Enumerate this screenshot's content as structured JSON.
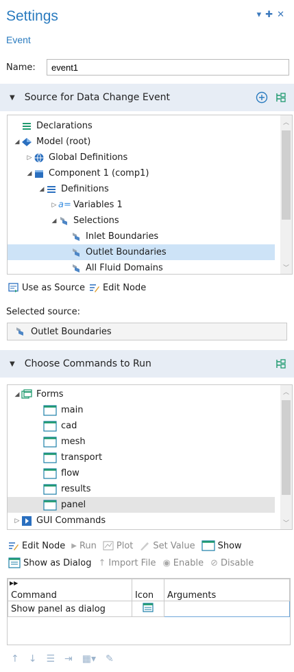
{
  "header": {
    "title": "Settings",
    "subtitle": "Event",
    "controls": "▾ ✚ ✕"
  },
  "name_field": {
    "label": "Name:",
    "value": "event1"
  },
  "section_source": {
    "title": "Source for Data Change Event"
  },
  "source_tree": [
    {
      "label": "Declarations",
      "icon": "declarations-icon"
    },
    {
      "label": "Model (root)",
      "icon": "model-icon"
    },
    {
      "label": "Global Definitions",
      "icon": "globe-icon"
    },
    {
      "label": "Component 1 (comp1)",
      "icon": "component-icon"
    },
    {
      "label": "Definitions",
      "icon": "definitions-icon"
    },
    {
      "label": "Variables 1",
      "icon": "variables-icon"
    },
    {
      "label": "Selections",
      "icon": "selections-icon"
    },
    {
      "label": "Inlet Boundaries",
      "icon": "selection-item-icon"
    },
    {
      "label": "Outlet Boundaries",
      "icon": "selection-item-icon"
    },
    {
      "label": "All Fluid Domains",
      "icon": "selection-item-icon"
    }
  ],
  "source_toolbar": {
    "use_as_source": "Use as Source",
    "edit_node": "Edit Node"
  },
  "selected_source": {
    "label": "Selected source:",
    "value": "Outlet Boundaries"
  },
  "section_commands": {
    "title": "Choose Commands to Run"
  },
  "commands_tree": [
    {
      "label": "Forms"
    },
    {
      "label": "main"
    },
    {
      "label": "cad"
    },
    {
      "label": "mesh"
    },
    {
      "label": "transport"
    },
    {
      "label": "flow"
    },
    {
      "label": "results"
    },
    {
      "label": "panel"
    },
    {
      "label": "GUI Commands"
    }
  ],
  "commands_toolbar": {
    "edit_node": "Edit Node",
    "run": "Run",
    "plot": "Plot",
    "set_value": "Set Value",
    "show": "Show",
    "show_as_dialog": "Show as Dialog",
    "import_file": "Import File",
    "enable": "Enable",
    "disable": "Disable"
  },
  "command_table": {
    "headers": [
      "Command",
      "Icon",
      "Arguments"
    ],
    "rows": [
      {
        "command": "Show panel as dialog",
        "icon": "dialog-icon",
        "arguments": ""
      }
    ]
  },
  "colors": {
    "accent": "#2a7bbf",
    "section_bg": "#e7edf5",
    "selection": "#cde3f7",
    "green": "#1e9a6e"
  }
}
